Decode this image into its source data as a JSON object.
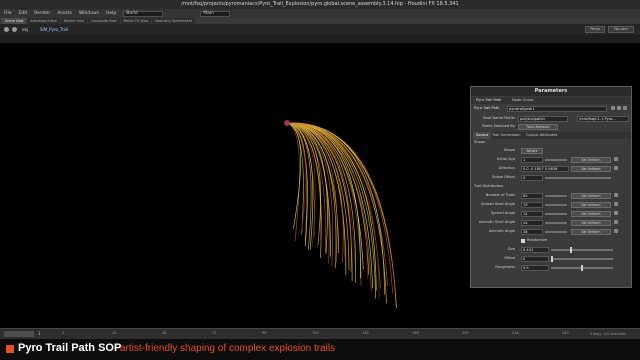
{
  "window": {
    "title": "/mnt/fsq/projects/pyromaniacs/Pyro_Trail_Explosion/pyro.global.scene_assembly.3.14.hip - Houdini FX 18.5.341"
  },
  "menu": {
    "items": [
      "File",
      "Edit",
      "Render",
      "Assets",
      "Windows",
      "Help"
    ],
    "desktop": "Build",
    "main_label": "Main",
    "shelf_tabs": [
      "Create",
      "Modify",
      "Model",
      "Polygon",
      "Deform",
      "Texture",
      "Rigging",
      "Characters",
      "Constraints",
      "Hair Utils",
      "Guide Process",
      "Terrain FX",
      "Simple FX",
      "Volume",
      "Lights and Cameras",
      "Collisions",
      "Particles",
      "Grains",
      "Vellum",
      "Rigid Bodies",
      "Particle Fluids",
      "Viscous Fluids",
      "Oceans",
      "Pyro FX"
    ],
    "pane_tabs": [
      "Scene View",
      "Animation Editor",
      "Render View",
      "Composite View",
      "Motion FX View",
      "Geometry Spreadsheet"
    ],
    "path": "obj",
    "node": "SIM_Pyro_Trail"
  },
  "viewport": {
    "persp_label": "Persp",
    "cam_label": "No cam",
    "trail_colors": [
      "#d7c93e",
      "#e6e04a",
      "#c05a2a",
      "#8e2a1c"
    ]
  },
  "params": {
    "title": "Parameters",
    "tabs": [
      "Pyro Trail Path",
      "Node Group"
    ],
    "node_type": "Pyro Trail Path",
    "node_name": "pyrotrailpath1",
    "root_name": {
      "label": "Root Name Points",
      "value": "polytrailpath1",
      "right": "/mnt/fsq/f-1.1 Pyro..."
    },
    "points_by": {
      "label": "Points Selected By",
      "value": "Point Attribute"
    },
    "section_tabs": [
      "Source",
      "Trail Generation",
      "Output Attributes"
    ],
    "shape_header": "Shape",
    "shape": [
      {
        "label": "Shape",
        "value": "Sphere"
      },
      {
        "label": "Initial Spd",
        "value": "1",
        "btn": "Set Uniform"
      },
      {
        "label": "Direction",
        "value": "0.0   -0.1807  0.9836",
        "btn": "Set Uniform"
      },
      {
        "label": "Shape Offset",
        "value": "0"
      }
    ],
    "trail_header": "Trail Distribution",
    "trails": [
      {
        "label": "Number of Trails",
        "value": "62",
        "btn": "Set Uniform"
      },
      {
        "label": "Spread Start Angle",
        "value": "15",
        "btn": "Set Uniform"
      },
      {
        "label": "Spread Angle",
        "value": "14",
        "btn": "Set Uniform"
      },
      {
        "label": "Azimuth Start Angle",
        "value": "24",
        "btn": "Set Uniform"
      },
      {
        "label": "Azimuth Angle",
        "value": "28",
        "btn": "Set Uniform"
      }
    ],
    "randomize_label": "Randomize",
    "noise": [
      {
        "label": "Size",
        "value": "0.441",
        "level": 0.32
      },
      {
        "label": "Offset",
        "value": "0",
        "level": 0.0
      },
      {
        "label": "Roughness",
        "value": "0.5",
        "level": 0.5
      }
    ]
  },
  "timeline": {
    "frame": "1",
    "start": "1",
    "end": "240",
    "ticks": [
      "1",
      "24",
      "48",
      "72",
      "96",
      "120",
      "144",
      "168",
      "192",
      "216",
      "240"
    ],
    "right_text": "0 keys, 0/0 channels"
  },
  "caption": {
    "title": "Pyro Trail Path SOP",
    "subtitle": "artist-friendly shaping of complex explosion trails",
    "accent": "#e8501e"
  }
}
